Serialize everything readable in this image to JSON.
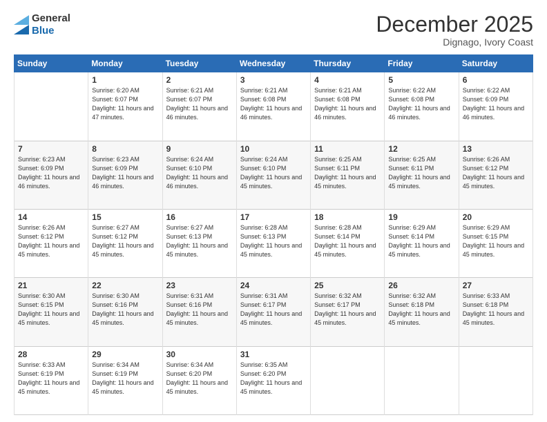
{
  "header": {
    "logo": {
      "general": "General",
      "blue": "Blue"
    },
    "title": "December 2025",
    "location": "Dignago, Ivory Coast"
  },
  "weekdays": [
    "Sunday",
    "Monday",
    "Tuesday",
    "Wednesday",
    "Thursday",
    "Friday",
    "Saturday"
  ],
  "weeks": [
    [
      {
        "day": "",
        "sunrise": "",
        "sunset": "",
        "daylight": ""
      },
      {
        "day": "1",
        "sunrise": "Sunrise: 6:20 AM",
        "sunset": "Sunset: 6:07 PM",
        "daylight": "Daylight: 11 hours and 47 minutes."
      },
      {
        "day": "2",
        "sunrise": "Sunrise: 6:21 AM",
        "sunset": "Sunset: 6:07 PM",
        "daylight": "Daylight: 11 hours and 46 minutes."
      },
      {
        "day": "3",
        "sunrise": "Sunrise: 6:21 AM",
        "sunset": "Sunset: 6:08 PM",
        "daylight": "Daylight: 11 hours and 46 minutes."
      },
      {
        "day": "4",
        "sunrise": "Sunrise: 6:21 AM",
        "sunset": "Sunset: 6:08 PM",
        "daylight": "Daylight: 11 hours and 46 minutes."
      },
      {
        "day": "5",
        "sunrise": "Sunrise: 6:22 AM",
        "sunset": "Sunset: 6:08 PM",
        "daylight": "Daylight: 11 hours and 46 minutes."
      },
      {
        "day": "6",
        "sunrise": "Sunrise: 6:22 AM",
        "sunset": "Sunset: 6:09 PM",
        "daylight": "Daylight: 11 hours and 46 minutes."
      }
    ],
    [
      {
        "day": "7",
        "sunrise": "Sunrise: 6:23 AM",
        "sunset": "Sunset: 6:09 PM",
        "daylight": "Daylight: 11 hours and 46 minutes."
      },
      {
        "day": "8",
        "sunrise": "Sunrise: 6:23 AM",
        "sunset": "Sunset: 6:09 PM",
        "daylight": "Daylight: 11 hours and 46 minutes."
      },
      {
        "day": "9",
        "sunrise": "Sunrise: 6:24 AM",
        "sunset": "Sunset: 6:10 PM",
        "daylight": "Daylight: 11 hours and 46 minutes."
      },
      {
        "day": "10",
        "sunrise": "Sunrise: 6:24 AM",
        "sunset": "Sunset: 6:10 PM",
        "daylight": "Daylight: 11 hours and 45 minutes."
      },
      {
        "day": "11",
        "sunrise": "Sunrise: 6:25 AM",
        "sunset": "Sunset: 6:11 PM",
        "daylight": "Daylight: 11 hours and 45 minutes."
      },
      {
        "day": "12",
        "sunrise": "Sunrise: 6:25 AM",
        "sunset": "Sunset: 6:11 PM",
        "daylight": "Daylight: 11 hours and 45 minutes."
      },
      {
        "day": "13",
        "sunrise": "Sunrise: 6:26 AM",
        "sunset": "Sunset: 6:12 PM",
        "daylight": "Daylight: 11 hours and 45 minutes."
      }
    ],
    [
      {
        "day": "14",
        "sunrise": "Sunrise: 6:26 AM",
        "sunset": "Sunset: 6:12 PM",
        "daylight": "Daylight: 11 hours and 45 minutes."
      },
      {
        "day": "15",
        "sunrise": "Sunrise: 6:27 AM",
        "sunset": "Sunset: 6:12 PM",
        "daylight": "Daylight: 11 hours and 45 minutes."
      },
      {
        "day": "16",
        "sunrise": "Sunrise: 6:27 AM",
        "sunset": "Sunset: 6:13 PM",
        "daylight": "Daylight: 11 hours and 45 minutes."
      },
      {
        "day": "17",
        "sunrise": "Sunrise: 6:28 AM",
        "sunset": "Sunset: 6:13 PM",
        "daylight": "Daylight: 11 hours and 45 minutes."
      },
      {
        "day": "18",
        "sunrise": "Sunrise: 6:28 AM",
        "sunset": "Sunset: 6:14 PM",
        "daylight": "Daylight: 11 hours and 45 minutes."
      },
      {
        "day": "19",
        "sunrise": "Sunrise: 6:29 AM",
        "sunset": "Sunset: 6:14 PM",
        "daylight": "Daylight: 11 hours and 45 minutes."
      },
      {
        "day": "20",
        "sunrise": "Sunrise: 6:29 AM",
        "sunset": "Sunset: 6:15 PM",
        "daylight": "Daylight: 11 hours and 45 minutes."
      }
    ],
    [
      {
        "day": "21",
        "sunrise": "Sunrise: 6:30 AM",
        "sunset": "Sunset: 6:15 PM",
        "daylight": "Daylight: 11 hours and 45 minutes."
      },
      {
        "day": "22",
        "sunrise": "Sunrise: 6:30 AM",
        "sunset": "Sunset: 6:16 PM",
        "daylight": "Daylight: 11 hours and 45 minutes."
      },
      {
        "day": "23",
        "sunrise": "Sunrise: 6:31 AM",
        "sunset": "Sunset: 6:16 PM",
        "daylight": "Daylight: 11 hours and 45 minutes."
      },
      {
        "day": "24",
        "sunrise": "Sunrise: 6:31 AM",
        "sunset": "Sunset: 6:17 PM",
        "daylight": "Daylight: 11 hours and 45 minutes."
      },
      {
        "day": "25",
        "sunrise": "Sunrise: 6:32 AM",
        "sunset": "Sunset: 6:17 PM",
        "daylight": "Daylight: 11 hours and 45 minutes."
      },
      {
        "day": "26",
        "sunrise": "Sunrise: 6:32 AM",
        "sunset": "Sunset: 6:18 PM",
        "daylight": "Daylight: 11 hours and 45 minutes."
      },
      {
        "day": "27",
        "sunrise": "Sunrise: 6:33 AM",
        "sunset": "Sunset: 6:18 PM",
        "daylight": "Daylight: 11 hours and 45 minutes."
      }
    ],
    [
      {
        "day": "28",
        "sunrise": "Sunrise: 6:33 AM",
        "sunset": "Sunset: 6:19 PM",
        "daylight": "Daylight: 11 hours and 45 minutes."
      },
      {
        "day": "29",
        "sunrise": "Sunrise: 6:34 AM",
        "sunset": "Sunset: 6:19 PM",
        "daylight": "Daylight: 11 hours and 45 minutes."
      },
      {
        "day": "30",
        "sunrise": "Sunrise: 6:34 AM",
        "sunset": "Sunset: 6:20 PM",
        "daylight": "Daylight: 11 hours and 45 minutes."
      },
      {
        "day": "31",
        "sunrise": "Sunrise: 6:35 AM",
        "sunset": "Sunset: 6:20 PM",
        "daylight": "Daylight: 11 hours and 45 minutes."
      },
      {
        "day": "",
        "sunrise": "",
        "sunset": "",
        "daylight": ""
      },
      {
        "day": "",
        "sunrise": "",
        "sunset": "",
        "daylight": ""
      },
      {
        "day": "",
        "sunrise": "",
        "sunset": "",
        "daylight": ""
      }
    ]
  ]
}
